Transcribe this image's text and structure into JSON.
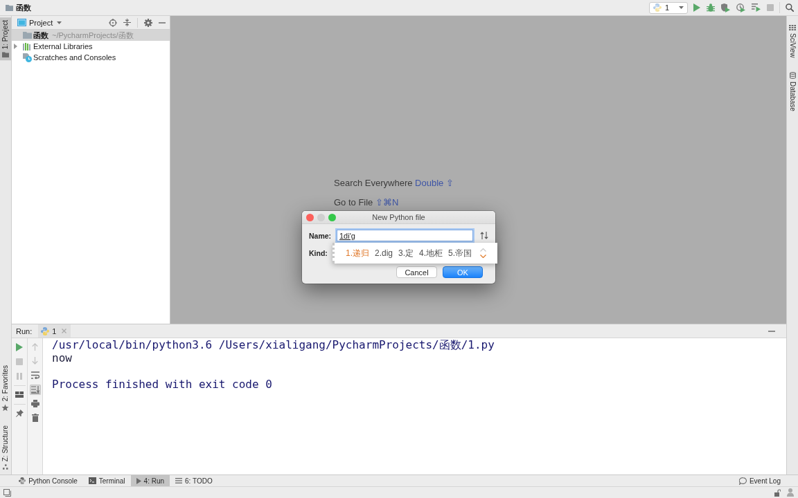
{
  "window": {
    "title": "函数"
  },
  "toolbar": {
    "run_config": "1",
    "buttons": [
      {
        "kind": "run",
        "disabled": false
      },
      {
        "kind": "debug",
        "disabled": false
      },
      {
        "kind": "coverage",
        "disabled": false
      },
      {
        "kind": "profile",
        "disabled": false
      },
      {
        "kind": "concurrency",
        "disabled": false
      },
      {
        "kind": "stop",
        "disabled": true
      },
      {
        "kind": "search",
        "disabled": false
      }
    ]
  },
  "left_stripe": {
    "top": [
      {
        "kind": "project",
        "label": "1: Project",
        "selected": true
      }
    ],
    "bottom": [
      {
        "kind": "favorites",
        "label": "2: Favorites",
        "selected": false
      },
      {
        "kind": "structure",
        "label": "Z: Structure",
        "selected": false
      }
    ]
  },
  "project_panel": {
    "title": "Project",
    "tree": [
      {
        "kind": "folder",
        "name": "函数",
        "path": "~/PycharmProjects/函数",
        "selected": true
      },
      {
        "kind": "library",
        "name": "External Libraries",
        "expanded": false,
        "selected": false
      },
      {
        "kind": "scratches",
        "name": "Scratches and Consoles",
        "selected": false
      }
    ]
  },
  "editor": {
    "hints": [
      {
        "action": "Search Everywhere",
        "shortcut": "Double ⇧"
      },
      {
        "action": "Go to File",
        "shortcut": "⇧⌘N"
      }
    ]
  },
  "dialog": {
    "title": "New Python file",
    "window_buttons": [
      {
        "kind": "close",
        "disabled": false
      },
      {
        "kind": "minimize",
        "disabled": true
      },
      {
        "kind": "zoom",
        "disabled": false
      }
    ],
    "name_field": {
      "label": "Name:",
      "value": "1di'g",
      "focused": true,
      "composing": true
    },
    "kind_field": {
      "label": "Kind:"
    },
    "ime": {
      "candidates": [
        {
          "text": "1.递归",
          "selected": true
        },
        {
          "text": "2.dig",
          "selected": false
        },
        {
          "text": "3.定",
          "selected": false
        },
        {
          "text": "4.地柜",
          "selected": false
        },
        {
          "text": "5.帝国",
          "selected": false
        }
      ],
      "page_up": false,
      "page_down": true
    },
    "buttons": [
      {
        "kind": "secondary",
        "label": "Cancel"
      },
      {
        "kind": "primary",
        "label": "OK"
      }
    ]
  },
  "right_stripe": [
    {
      "kind": "sciview",
      "label": "SciView",
      "selected": false
    },
    {
      "kind": "database",
      "label": "Database",
      "selected": false
    }
  ],
  "run_panel": {
    "title": "Run:",
    "tabs": [
      {
        "label": "1",
        "selected": true
      }
    ],
    "left_toolbar": [
      {
        "kind": "run",
        "disabled": false
      },
      {
        "kind": "stop",
        "disabled": true
      },
      {
        "kind": "pause",
        "disabled": true
      },
      {
        "kind": "layout",
        "disabled": false
      },
      {
        "kind": "pin",
        "disabled": false
      }
    ],
    "right_toolbar": [
      {
        "kind": "up",
        "disabled": true
      },
      {
        "kind": "down",
        "disabled": true
      },
      {
        "kind": "wrap",
        "disabled": false,
        "on": false
      },
      {
        "kind": "scroll_end",
        "disabled": false,
        "on": true
      },
      {
        "kind": "print",
        "disabled": false
      },
      {
        "kind": "trash",
        "disabled": false
      }
    ],
    "console": [
      {
        "kind": "command",
        "text": "/usr/local/bin/python3.6 /Users/xialigang/PycharmProjects/函数/1.py"
      },
      {
        "kind": "output",
        "text": "now"
      },
      {
        "kind": "exit",
        "text": "Process finished with exit code 0"
      }
    ]
  },
  "bottom_tabs": [
    {
      "kind": "console",
      "label": "Python Console",
      "selected": false
    },
    {
      "kind": "terminal",
      "label": "Terminal",
      "selected": false
    },
    {
      "kind": "run",
      "label": "4: Run",
      "selected": true
    },
    {
      "kind": "todo",
      "label": "6: TODO",
      "selected": false
    }
  ],
  "event_log": {
    "label": "Event Log"
  }
}
